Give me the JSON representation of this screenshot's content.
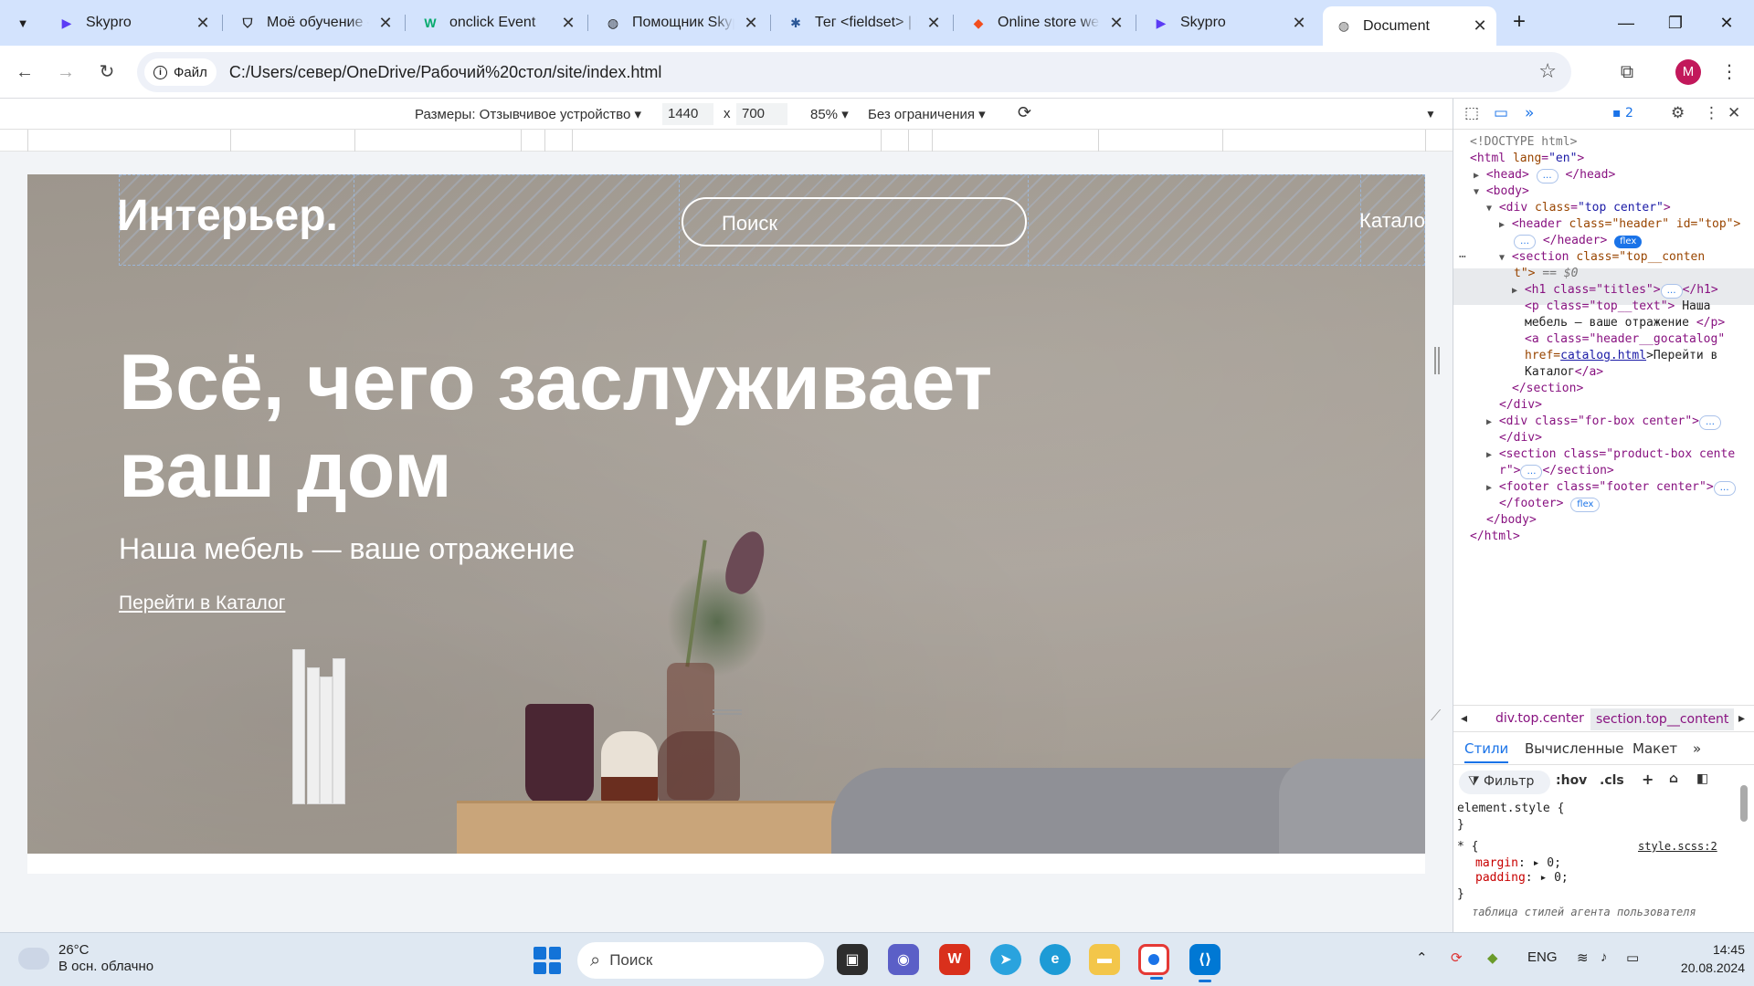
{
  "browser": {
    "tabs": [
      {
        "title": "Skypro",
        "icon": "skypro-icon",
        "color": "#5b3bf5"
      },
      {
        "title": "Моё обучение — ",
        "icon": "shield-icon",
        "color": "#333333"
      },
      {
        "title": "onclick Event",
        "icon": "w3schools-icon",
        "color": "#04aa6d"
      },
      {
        "title": "Помощник Skypro",
        "icon": "globe-icon",
        "color": "#333333"
      },
      {
        "title": "Тег <fieldset> | HTML",
        "icon": "gear-icon",
        "color": "#2b5797"
      },
      {
        "title": "Online store website",
        "icon": "figma-icon",
        "color": "#f24e1e"
      },
      {
        "title": "Skypro",
        "icon": "skypro-icon",
        "color": "#5b3bf5"
      },
      {
        "title": "Document",
        "icon": "globe-icon",
        "color": "#555555"
      }
    ],
    "address": {
      "chip_label": "Файл",
      "url": "C:/Users/север/OneDrive/Рабочий%20стол/site/index.html"
    },
    "profile_initial": "M"
  },
  "device_toolbar": {
    "dimensions_label": "Размеры: Отзывчивое устройство",
    "width": "1440",
    "times": "x",
    "height": "700",
    "zoom": "85%",
    "throttle": "Без ограничения"
  },
  "site": {
    "logo": "Интерьер.",
    "search_placeholder": "Поиск",
    "catalog_link": "Катало",
    "hero_title": "Всё, чего заслуживает ваш дом",
    "hero_subtitle": "Наша мебель — ваше отражение",
    "hero_link": "Перейти в Каталог"
  },
  "devtools": {
    "issues_count": "2",
    "dom": {
      "doctype": "<!DOCTYPE html>",
      "html_open_tag": "<html ",
      "html_lang_attr": "lang",
      "html_lang_val": "\"en\"",
      "head": "<head>",
      "head_close": "</head>",
      "body": "<body>",
      "div_top": "<div ",
      "div_top_class": "class",
      "div_top_val": "\"top center\"",
      "header_tag": "<header ",
      "header_attrs": "class=\"header\" id=\"top\">",
      "header_close": "</header>",
      "flex": "flex",
      "section_tag": "<section ",
      "section_class_a": "class=\"top__conten",
      "section_class_b": "t\">",
      "eq": "== $0",
      "h1": "<h1 class=\"titles\">",
      "h1_close": "</h1>",
      "p_tag": "<p class=\"top__text\">",
      "p_text_a": "Наша",
      "p_text_b": "мебель — ваше отражение ",
      "p_close": "</p>",
      "a_tag": "<a class=\"header__gocatalog\"",
      "a_href_attr": "href=",
      "a_href_val": "catalog.html",
      "a_text_a": ">Перейти в",
      "a_text_b": "Каталог",
      "a_close": "</a>",
      "section_close": "</section>",
      "div_close": "</div>",
      "div_forbox": "<div class=\"for-box center\">",
      "div_close2": "</div>",
      "section_product_a": "<section class=\"product-box cente",
      "section_product_b": "r\">",
      "section_close2": "</section>",
      "footer_tag": "<footer class=\"footer center\">",
      "footer_close": "</footer>",
      "body_close": "</body>",
      "html_close": "</html>"
    },
    "breadcrumbs": [
      "div.top.center",
      "section.top__content"
    ],
    "panel_tabs": [
      "Стили",
      "Вычисленные",
      "Макет"
    ],
    "filter": "Фильтр",
    "hov": ":hov",
    "cls": ".cls",
    "styles": {
      "element_style": "element.style {",
      "brace_close": "}",
      "star_rule": "* {",
      "source": "style.scss:2",
      "margin_prop": "margin",
      "margin_val": "0;",
      "padding_prop": "padding",
      "padding_val": "0;",
      "ua_comment": "таблица стилей агента пользователя"
    }
  },
  "taskbar": {
    "temperature": "26°C",
    "weather": "В осн. облачно",
    "search": "Поиск",
    "lang": "ENG",
    "time": "14:45",
    "date": "20.08.2024"
  }
}
